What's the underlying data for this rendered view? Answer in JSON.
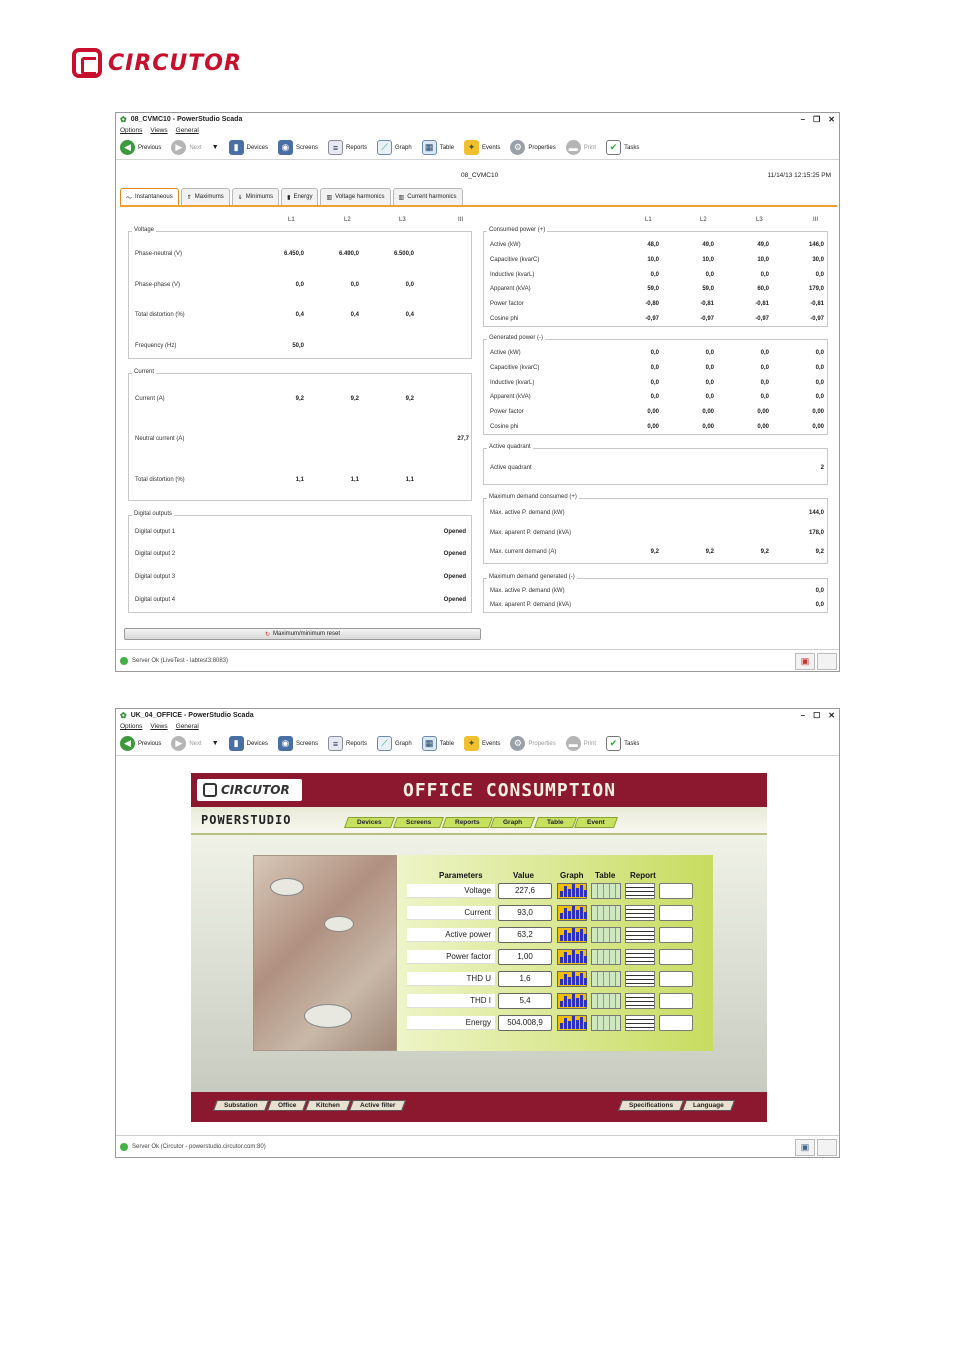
{
  "brand": {
    "logo_text": "CIRCUTOR"
  },
  "window1": {
    "title": "08_CVMC10 - PowerStudio Scada",
    "menu": [
      "Options",
      "Views",
      "General"
    ],
    "toolbar": [
      "Previous",
      "Next",
      "Devices",
      "Screens",
      "Reports",
      "Graph",
      "Table",
      "Events",
      "Properties",
      "Print",
      "Tasks"
    ],
    "device_name": "08_CVMC10",
    "timestamp": "11/14/13 12:15:25 PM",
    "tabs": [
      "Instantaneous",
      "Maximums",
      "Minimums",
      "Energy",
      "Voltage harmonics",
      "Current harmonics"
    ],
    "left_cols": [
      "L1",
      "L2",
      "L3",
      "III"
    ],
    "right_cols": [
      "L1",
      "L2",
      "L3",
      "III"
    ],
    "voltage": {
      "title": "Voltage",
      "rows": [
        {
          "label": "Phase-neutral (V)",
          "l1": "6.450,0",
          "l2": "6.490,0",
          "l3": "6.500,0"
        },
        {
          "label": "Phase-phase (V)",
          "l1": "0,0",
          "l2": "0,0",
          "l3": "0,0"
        },
        {
          "label": "Total distortion (%)",
          "l1": "0,4",
          "l2": "0,4",
          "l3": "0,4"
        },
        {
          "label": "Frequency (Hz)",
          "l1": "50,0",
          "l2": "",
          "l3": ""
        }
      ]
    },
    "current": {
      "title": "Current",
      "rows": [
        {
          "label": "Current (A)",
          "l1": "9,2",
          "l2": "9,2",
          "l3": "9,2",
          "iii": ""
        },
        {
          "label": "Neutral current (A)",
          "l1": "",
          "l2": "",
          "l3": "",
          "iii": "27,7"
        },
        {
          "label": "Total distortion (%)",
          "l1": "1,1",
          "l2": "1,1",
          "l3": "1,1",
          "iii": ""
        }
      ]
    },
    "digital": {
      "title": "Digital outputs",
      "rows": [
        {
          "label": "Digital output 1",
          "value": "Opened"
        },
        {
          "label": "Digital output 2",
          "value": "Opened"
        },
        {
          "label": "Digital output 3",
          "value": "Opened"
        },
        {
          "label": "Digital output 4",
          "value": "Opened"
        }
      ]
    },
    "consumed": {
      "title": "Consumed power (+)",
      "rows": [
        {
          "label": "Active (kW)",
          "l1": "48,0",
          "l2": "49,0",
          "l3": "49,0",
          "iii": "146,0"
        },
        {
          "label": "Capacitive (kvarC)",
          "l1": "10,0",
          "l2": "10,0",
          "l3": "10,0",
          "iii": "30,0"
        },
        {
          "label": "Inductive (kvarL)",
          "l1": "0,0",
          "l2": "0,0",
          "l3": "0,0",
          "iii": "0,0"
        },
        {
          "label": "Apparent (kVA)",
          "l1": "59,0",
          "l2": "59,0",
          "l3": "60,0",
          "iii": "179,0"
        },
        {
          "label": "Power factor",
          "l1": "-0,80",
          "l2": "-0,81",
          "l3": "-0,81",
          "iii": "-0,81"
        },
        {
          "label": "Cosine phi",
          "l1": "-0,97",
          "l2": "-0,97",
          "l3": "-0,97",
          "iii": "-0,97"
        }
      ]
    },
    "generated": {
      "title": "Generated power (-)",
      "rows": [
        {
          "label": "Active (kW)",
          "l1": "0,0",
          "l2": "0,0",
          "l3": "0,0",
          "iii": "0,0"
        },
        {
          "label": "Capacitive (kvarC)",
          "l1": "0,0",
          "l2": "0,0",
          "l3": "0,0",
          "iii": "0,0"
        },
        {
          "label": "Inductive (kvarL)",
          "l1": "0,0",
          "l2": "0,0",
          "l3": "0,0",
          "iii": "0,0"
        },
        {
          "label": "Apparent (kVA)",
          "l1": "0,0",
          "l2": "0,0",
          "l3": "0,0",
          "iii": "0,0"
        },
        {
          "label": "Power factor",
          "l1": "0,00",
          "l2": "0,00",
          "l3": "0,00",
          "iii": "0,00"
        },
        {
          "label": "Cosine phi",
          "l1": "0,00",
          "l2": "0,00",
          "l3": "0,00",
          "iii": "0,00"
        }
      ]
    },
    "quadrant": {
      "title": "Active quadrant",
      "label": "Active quadrant",
      "value": "2"
    },
    "maxcons": {
      "title": "Maximum demand consumed (+)",
      "rows": [
        {
          "label": "Max. active P. demand (kW)",
          "l1": "",
          "l2": "",
          "l3": "",
          "iii": "144,0"
        },
        {
          "label": "Max. aparent P. demand (kVA)",
          "l1": "",
          "l2": "",
          "l3": "",
          "iii": "178,0"
        },
        {
          "label": "Max. current demand (A)",
          "l1": "9,2",
          "l2": "9,2",
          "l3": "9,2",
          "iii": "9,2"
        }
      ]
    },
    "maxgen": {
      "title": "Maximum demand generated (-)",
      "rows": [
        {
          "label": "Max. active P. demand (kW)",
          "iii": "0,0"
        },
        {
          "label": "Max. aparent P. demand (kVA)",
          "iii": "0,0"
        }
      ]
    },
    "reset_label": "Maximum/minimum reset",
    "status": "Server Ok (LiveTest - labtest3:8083)"
  },
  "window2": {
    "title": "UK_04_OFFICE - PowerStudio Scada",
    "menu": [
      "Options",
      "Views",
      "General"
    ],
    "toolbar": [
      "Previous",
      "Next",
      "Devices",
      "Screens",
      "Reports",
      "Graph",
      "Table",
      "Events",
      "Properties",
      "Print",
      "Tasks"
    ],
    "scada": {
      "logo": "CIRCUTOR",
      "title": "OFFICE CONSUMPTION",
      "powerstudio": "POWERSTUDIO",
      "nav": [
        "Devices",
        "Screens",
        "Reports",
        "Graph",
        "Table",
        "Event"
      ],
      "headers": [
        "Parameters",
        "Value",
        "Graph",
        "Table",
        "Report"
      ],
      "rows": [
        {
          "name": "Voltage",
          "value": "227,6"
        },
        {
          "name": "Current",
          "value": "93,0"
        },
        {
          "name": "Active power",
          "value": "63,2"
        },
        {
          "name": "Power factor",
          "value": "1,00"
        },
        {
          "name": "THD U",
          "value": "1,6"
        },
        {
          "name": "THD I",
          "value": "5,4"
        },
        {
          "name": "Energy",
          "value": "504.008,9"
        }
      ],
      "bottom_nav": [
        "Substation",
        "Office",
        "Kitchen",
        "Active filter"
      ],
      "bottom_right": [
        "Specifications",
        "Language"
      ]
    },
    "status": "Server Ok (Circutor - powerstudio.circutor.com:80)"
  }
}
